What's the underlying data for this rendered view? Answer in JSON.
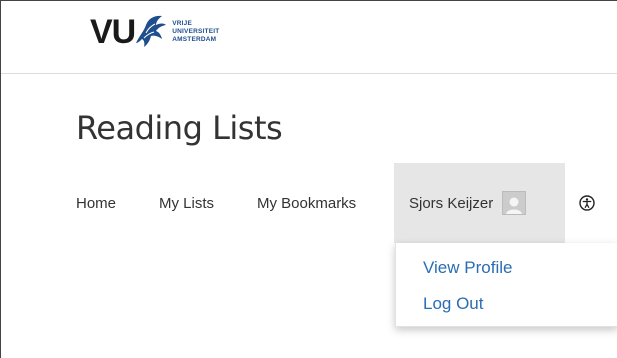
{
  "logo": {
    "wordmark": "VU",
    "line1": "VRIJE",
    "line2": "UNIVERSITEIT",
    "line3": "AMSTERDAM",
    "icon": "griffin-logo-icon",
    "color": "#1f4e8c"
  },
  "page": {
    "title": "Reading Lists"
  },
  "nav": {
    "home": "Home",
    "my_lists": "My Lists",
    "my_bookmarks": "My Bookmarks",
    "user_name": "Sjors Keijzer",
    "avatar_icon": "user-avatar-icon",
    "accessibility_icon": "accessibility-icon"
  },
  "user_menu": {
    "items": [
      {
        "label": "View Profile"
      },
      {
        "label": "Log Out"
      }
    ],
    "link_color": "#2a6db3"
  }
}
